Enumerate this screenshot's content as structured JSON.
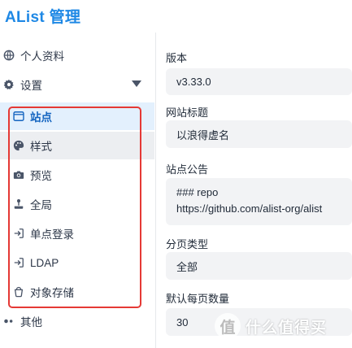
{
  "app": {
    "title": "AList 管理"
  },
  "sidebar": {
    "profile": {
      "label": "个人资料",
      "icon": "globe-icon"
    },
    "settings": {
      "label": "设置",
      "icon": "gear-icon",
      "expanded": true
    },
    "sub_items": [
      {
        "label": "站点",
        "icon": "window-icon",
        "active": true
      },
      {
        "label": "样式",
        "icon": "palette-icon",
        "hover": true
      },
      {
        "label": "预览",
        "icon": "camera-icon"
      },
      {
        "label": "全局",
        "icon": "joystick-icon"
      },
      {
        "label": "单点登录",
        "icon": "login-icon"
      },
      {
        "label": "LDAP",
        "icon": "login-icon"
      },
      {
        "label": "对象存储",
        "icon": "bucket-icon"
      }
    ],
    "other": {
      "label": "其他",
      "icon": "dots-icon"
    }
  },
  "form": {
    "version": {
      "label": "版本",
      "value": "v3.33.0"
    },
    "site_title": {
      "label": "网站标题",
      "value": "以浪得虚名"
    },
    "announcement": {
      "label": "站点公告",
      "value": "### repo\nhttps://github.com/alist-org/alist"
    },
    "pagination": {
      "label": "分页类型",
      "value": "全部"
    },
    "page_size": {
      "label": "默认每页数量",
      "value": "30"
    }
  },
  "watermark": {
    "logo": "值",
    "text": "什么值得买"
  },
  "colors": {
    "accent": "#1e88e5",
    "highlight_border": "#e53935",
    "active_bg": "#e3f0fd",
    "input_bg": "#f2f3f5"
  }
}
